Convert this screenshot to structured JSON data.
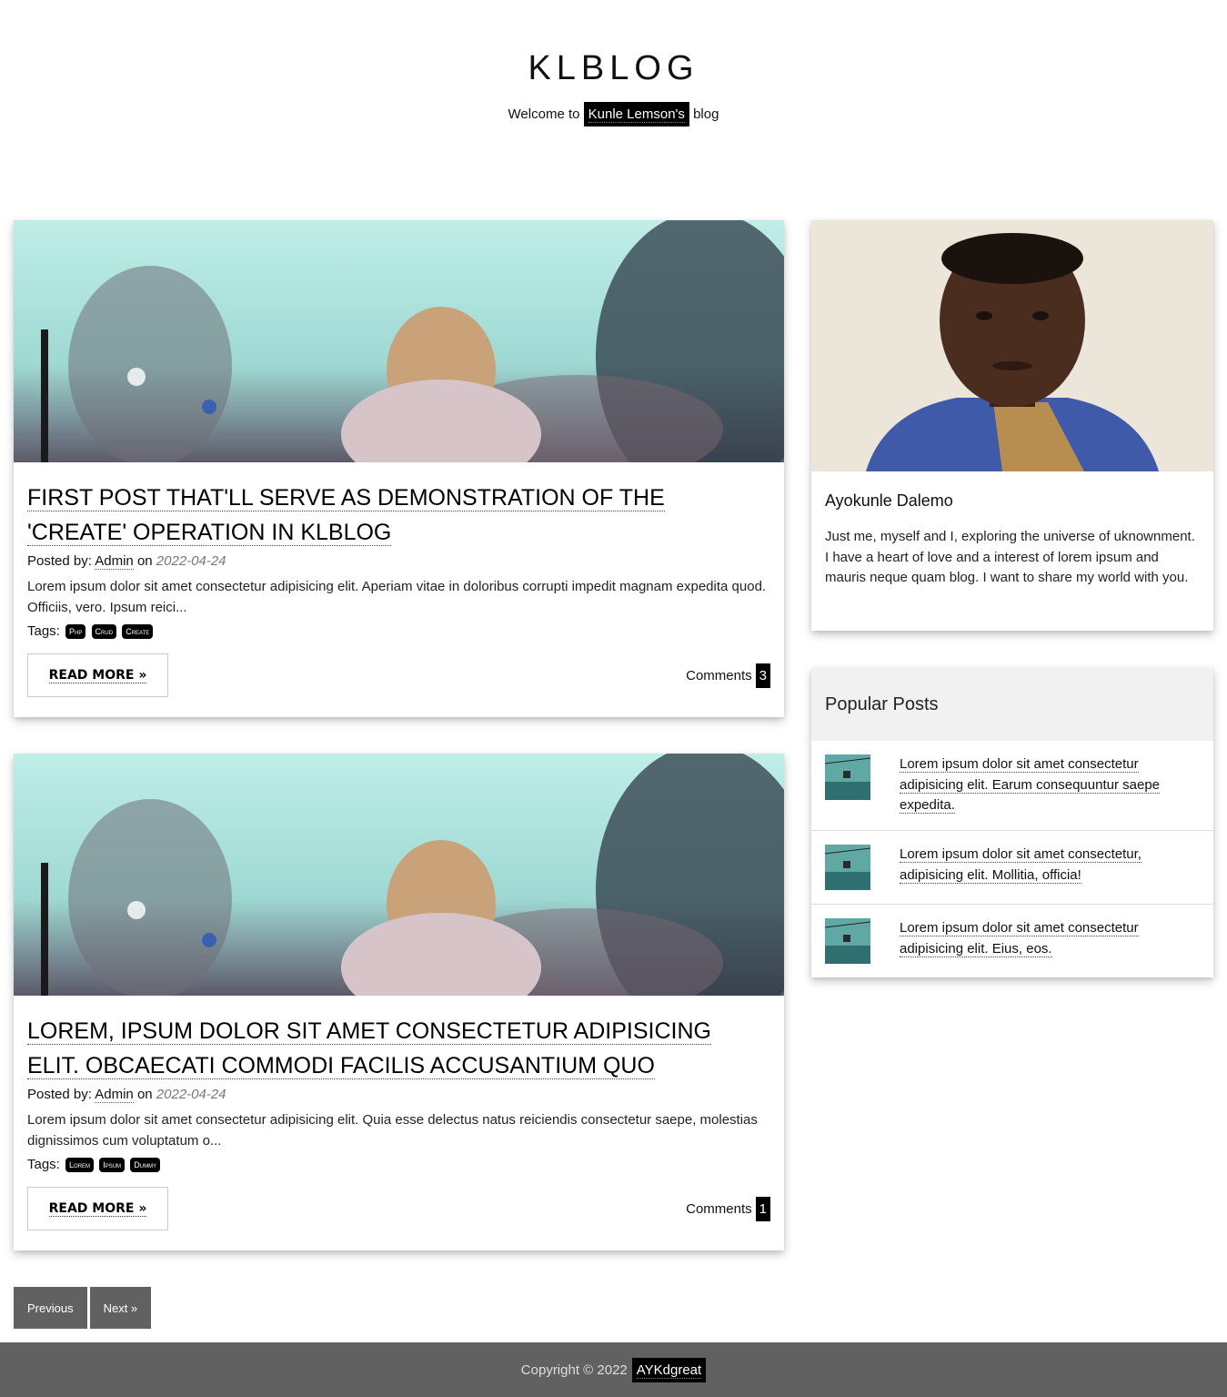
{
  "header": {
    "title": "KLBLOG",
    "welcome_prefix": "Welcome to",
    "welcome_name": "Kunle Lemson's",
    "welcome_suffix": "blog"
  },
  "posts": [
    {
      "title": "First post that'll serve as demonstration of the 'create' operation in klblog",
      "posted_by_label": "Posted by:",
      "author": "Admin",
      "on_label": "on",
      "date": "2022-04-24",
      "excerpt": "Lorem ipsum dolor sit amet consectetur adipisicing elit. Aperiam vitae in doloribus corrupti impedit magnam expedita quod. Officiis, vero. Ipsum reici...",
      "tags_label": "Tags:",
      "tags": [
        "Php",
        "Crud",
        "Create"
      ],
      "read_more": "READ MORE »",
      "comments_label": "Comments",
      "comments_count": "3"
    },
    {
      "title": "Lorem, ipsum dolor sit amet consectetur adipisicing elit. Obcaecati commodi facilis accusantium quo",
      "posted_by_label": "Posted by:",
      "author": "Admin",
      "on_label": "on",
      "date": "2022-04-24",
      "excerpt": "Lorem ipsum dolor sit amet consectetur adipisicing elit. Quia esse delectus natus reiciendis consectetur saepe, molestias dignissimos cum voluptatum o...",
      "tags_label": "Tags:",
      "tags": [
        "Lorem",
        "Ipsum",
        "Dummy"
      ],
      "read_more": "READ MORE »",
      "comments_label": "Comments",
      "comments_count": "1"
    }
  ],
  "profile": {
    "name": "Ayokunle Dalemo",
    "bio": "Just me, myself and I, exploring the universe of uknownment. I have a heart of love and a interest of lorem ipsum and mauris neque quam blog. I want to share my world with you."
  },
  "popular": {
    "heading": "Popular Posts",
    "items": [
      "Lorem ipsum dolor sit amet consectetur adipisicing elit. Earum consequuntur saepe expedita.",
      "Lorem ipsum dolor sit amet consectetur, adipisicing elit. Mollitia, officia!",
      "Lorem ipsum dolor sit amet consectetur adipisicing elit. Eius, eos."
    ]
  },
  "pagination": {
    "previous": "Previous",
    "next": "Next »"
  },
  "footer": {
    "copyright": "Copyright © 2022",
    "author": "AYKdgreat"
  }
}
